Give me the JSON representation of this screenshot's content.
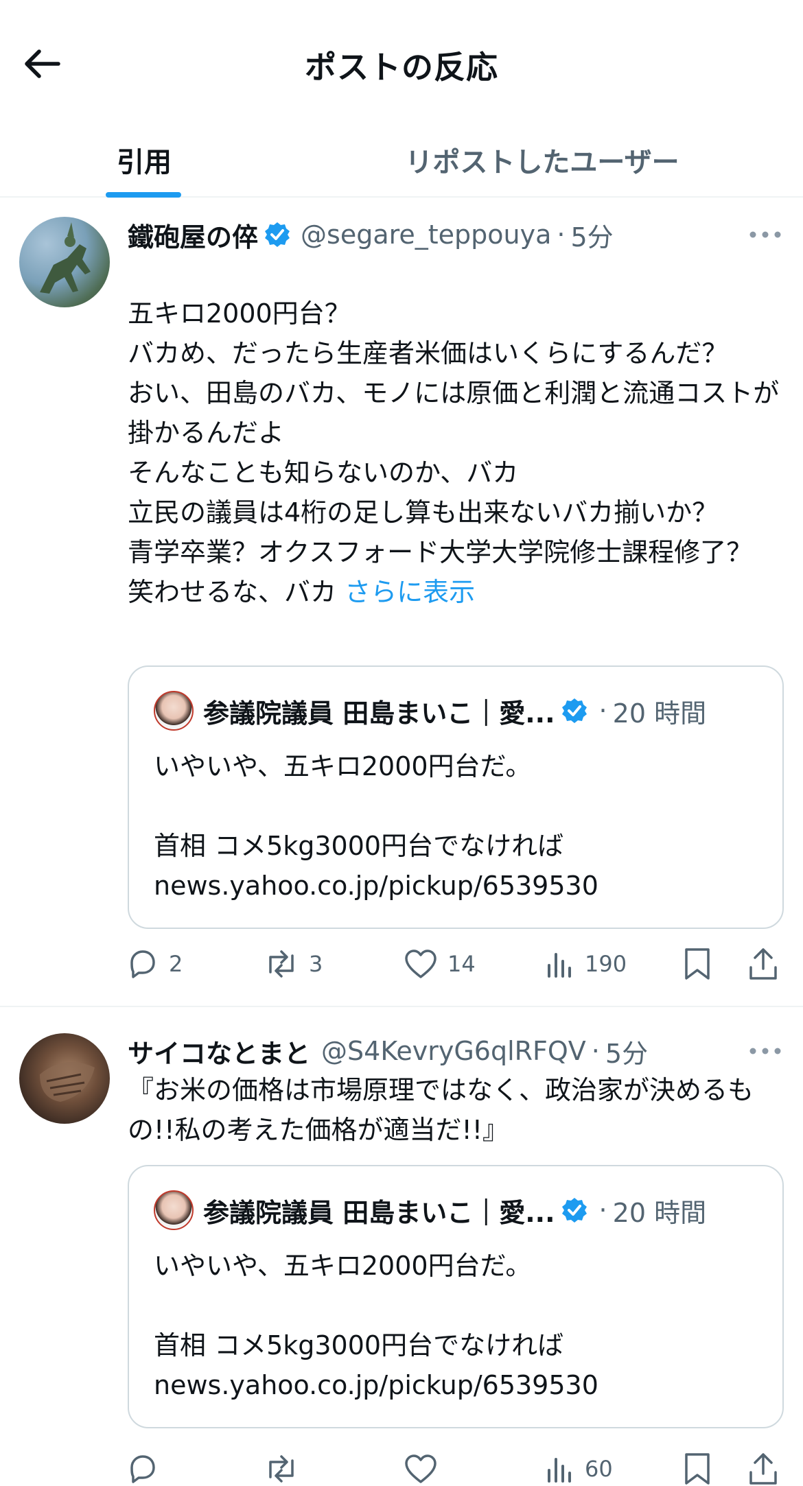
{
  "header": {
    "title": "ポストの反応"
  },
  "tabs": [
    {
      "label": "引用",
      "active": true
    },
    {
      "label": "リポストしたユーザー",
      "active": false
    }
  ],
  "colors": {
    "accent": "#1d9bf0",
    "text": "#0f1419",
    "secondary": "#536471",
    "border": "#eff3f4"
  },
  "posts": [
    {
      "name": "鐵砲屋の倅",
      "verified": true,
      "handle": "@segare_teppouya",
      "dot": "·",
      "time": "5分",
      "text": "五キロ2000円台？\nバカめ、だったら生産者米価はいくらにするんだ？\nおい、田島のバカ、モノには原価と利潤と流通コストが掛かるんだよ\nそんなことも知らないのか、バカ\n立民の議員は4桁の足し算も出来ないバカ揃いか？\n青学卒業？オクスフォード大学大学院修士課程修了？\n笑わせるな、バカ",
      "show_more": "さらに表示",
      "quote": {
        "name": "参議院議員 田島まいこ｜愛...",
        "dot": "·",
        "time": "20 時間",
        "text": "いやいや、五キロ2000円台だ。\n\n首相 コメ5kg3000円台でなければ\nnews.yahoo.co.jp/pickup/6539530"
      },
      "stats": {
        "replies": "2",
        "reposts": "3",
        "likes": "14",
        "views": "190"
      }
    },
    {
      "name": "サイコなとまと",
      "verified": false,
      "handle": "@S4KevryG6qlRFQV",
      "dot": "·",
      "time": "5分",
      "text": "『お米の価格は市場原理ではなく、政治家が決めるもの!!私の考えた価格が適当だ!!』",
      "quote": {
        "name": "参議院議員 田島まいこ｜愛...",
        "dot": "·",
        "time": "20 時間",
        "text": "いやいや、五キロ2000円台だ。\n\n首相 コメ5kg3000円台でなければ\nnews.yahoo.co.jp/pickup/6539530"
      },
      "stats": {
        "replies": "",
        "reposts": "",
        "likes": "",
        "views": "60"
      }
    }
  ]
}
